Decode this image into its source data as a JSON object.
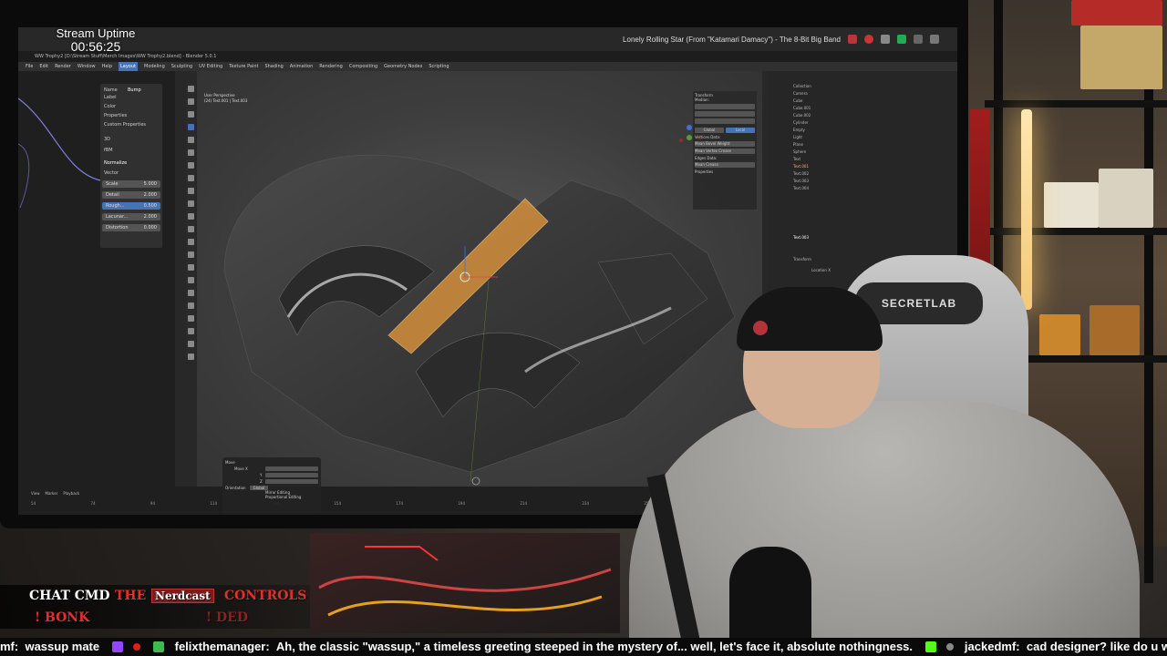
{
  "stream": {
    "uptime_label": "Stream Uptime",
    "uptime_value": "00:56:25",
    "now_playing": "Lonely Rolling Star (From \"Katamari Damacy\") - The 8-Bit Big Band"
  },
  "blender": {
    "window_title": "WW Trophy2 [D:\\Stream Stuff\\Merch Images\\WW Trophy2.blend] - Blender 5.0.1",
    "menus": [
      "File",
      "Edit",
      "Render",
      "Window",
      "Help",
      "Layout",
      "Modeling",
      "Sculpting",
      "UV Editing",
      "Texture Paint",
      "Shading",
      "Animation",
      "Rendering",
      "Compositing",
      "Geometry Nodes",
      "Scripting"
    ],
    "active_menu": "Layout",
    "viewport_info": [
      "User Perspective",
      "(24) Text.001 | Text.003"
    ],
    "node_panel": {
      "name_label": "Name",
      "name_value": "Bump",
      "label_label": "Label",
      "color_label": "Color",
      "properties_label": "Properties",
      "custom_properties_label": "Custom Properties",
      "dim_value": "3D",
      "type_value": "fBM",
      "normalize_label": "Normalize",
      "vector_label": "Vector",
      "rows": [
        {
          "label": "Scale",
          "value": "5.000",
          "selected": false
        },
        {
          "label": "Detail",
          "value": "2.000",
          "selected": false
        },
        {
          "label": "Rough...",
          "value": "0.500",
          "selected": true
        },
        {
          "label": "Lacunar...",
          "value": "2.000",
          "selected": false
        },
        {
          "label": "Distortion",
          "value": "0.000",
          "selected": false
        }
      ]
    },
    "n_panel": {
      "title": "Transform",
      "median_label": "Median:",
      "global_label": "Global",
      "local_label": "Local",
      "vertices_data_label": "Vertices Data:",
      "mean_vertex_weight": "Mean Bevel Weight",
      "mean_vertex_crease": "Mean Vertex Crease",
      "edges_data_label": "Edges Data:",
      "mean_crease": "Mean Crease",
      "properties_label": "Properties",
      "zero_value": "0.00"
    },
    "outliner_items": [
      "Collection",
      "Camera",
      "Cube",
      "Cube.001",
      "Cube.002",
      "Cylinder",
      "Empty",
      "Light",
      "Plane",
      "Sphere",
      "Text",
      "Text.001",
      "Text.002",
      "Text.003",
      "Text.004"
    ],
    "properties_object": "Text.003",
    "properties_transform": "Transform",
    "properties_location": "Location X",
    "operator_panel": {
      "title": "Move",
      "move_label": "Move X",
      "y_label": "Y",
      "z_label": "Z",
      "orientation_label": "Orientation",
      "orientation_value": "Global",
      "mirror_label": "Mirror Editing",
      "proportional_label": "Proportional Editing"
    },
    "timeline_menus": [
      "View",
      "Marker",
      "Playback"
    ],
    "timeline_ticks": [
      "54",
      "74",
      "94",
      "114",
      "134",
      "154",
      "174",
      "194",
      "214",
      "234",
      "254"
    ]
  },
  "chair_brand": "SECRETLAB",
  "chat_commands": {
    "line1": [
      "CHAT CMD",
      "THE",
      "Nerdcast",
      "CONTROLS"
    ],
    "line2": [
      "! BONK",
      "! DED"
    ]
  },
  "ticker": {
    "items": [
      {
        "user": "mf",
        "msg": "wassup mate"
      },
      {
        "user": "felixthemanager",
        "msg": "Ah, the classic \"wassup,\" a timeless greeting steeped in the mystery of... well, let's face it, absolute nothingness."
      },
      {
        "user": "jackedmf",
        "msg": "cad designer? like do u work for movie firms?"
      }
    ]
  },
  "colors": {
    "blender_accent": "#4772b3",
    "selection_orange": "#e89a3c",
    "cmd_red": "#e03030"
  }
}
